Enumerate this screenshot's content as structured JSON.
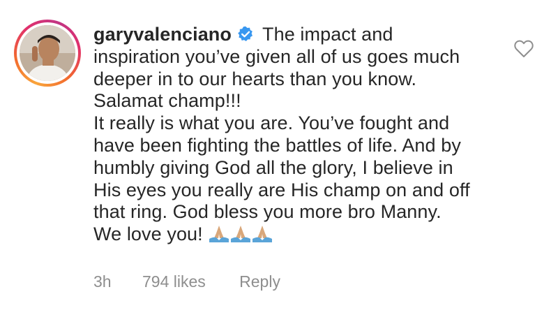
{
  "comment": {
    "username": "garyvalenciano",
    "verified_icon": "verified-badge-icon",
    "lines": [
      "The impact and",
      "inspiration you’ve given all of us goes much",
      "deeper in to our hearts than you know.",
      "Salamat champ!!!",
      "It really is what you are. You’ve fought and",
      "have been fighting the battles of life. And by",
      "humbly giving God all the glory, I believe in",
      "His eyes you really are His champ on and off",
      "that ring. God bless you more bro Manny.",
      "We love you!"
    ],
    "emojis": [
      "🙏🏼",
      "🙏🏼",
      "🙏🏼"
    ]
  },
  "meta": {
    "time": "3h",
    "likes": "794 likes",
    "reply": "Reply"
  },
  "icons": {
    "like": "heart-outline-icon"
  },
  "colors": {
    "text": "#262626",
    "muted": "#8e8e8e",
    "verified": "#3897f0",
    "ring_start": "#f9a53b",
    "ring_end": "#c13584"
  }
}
